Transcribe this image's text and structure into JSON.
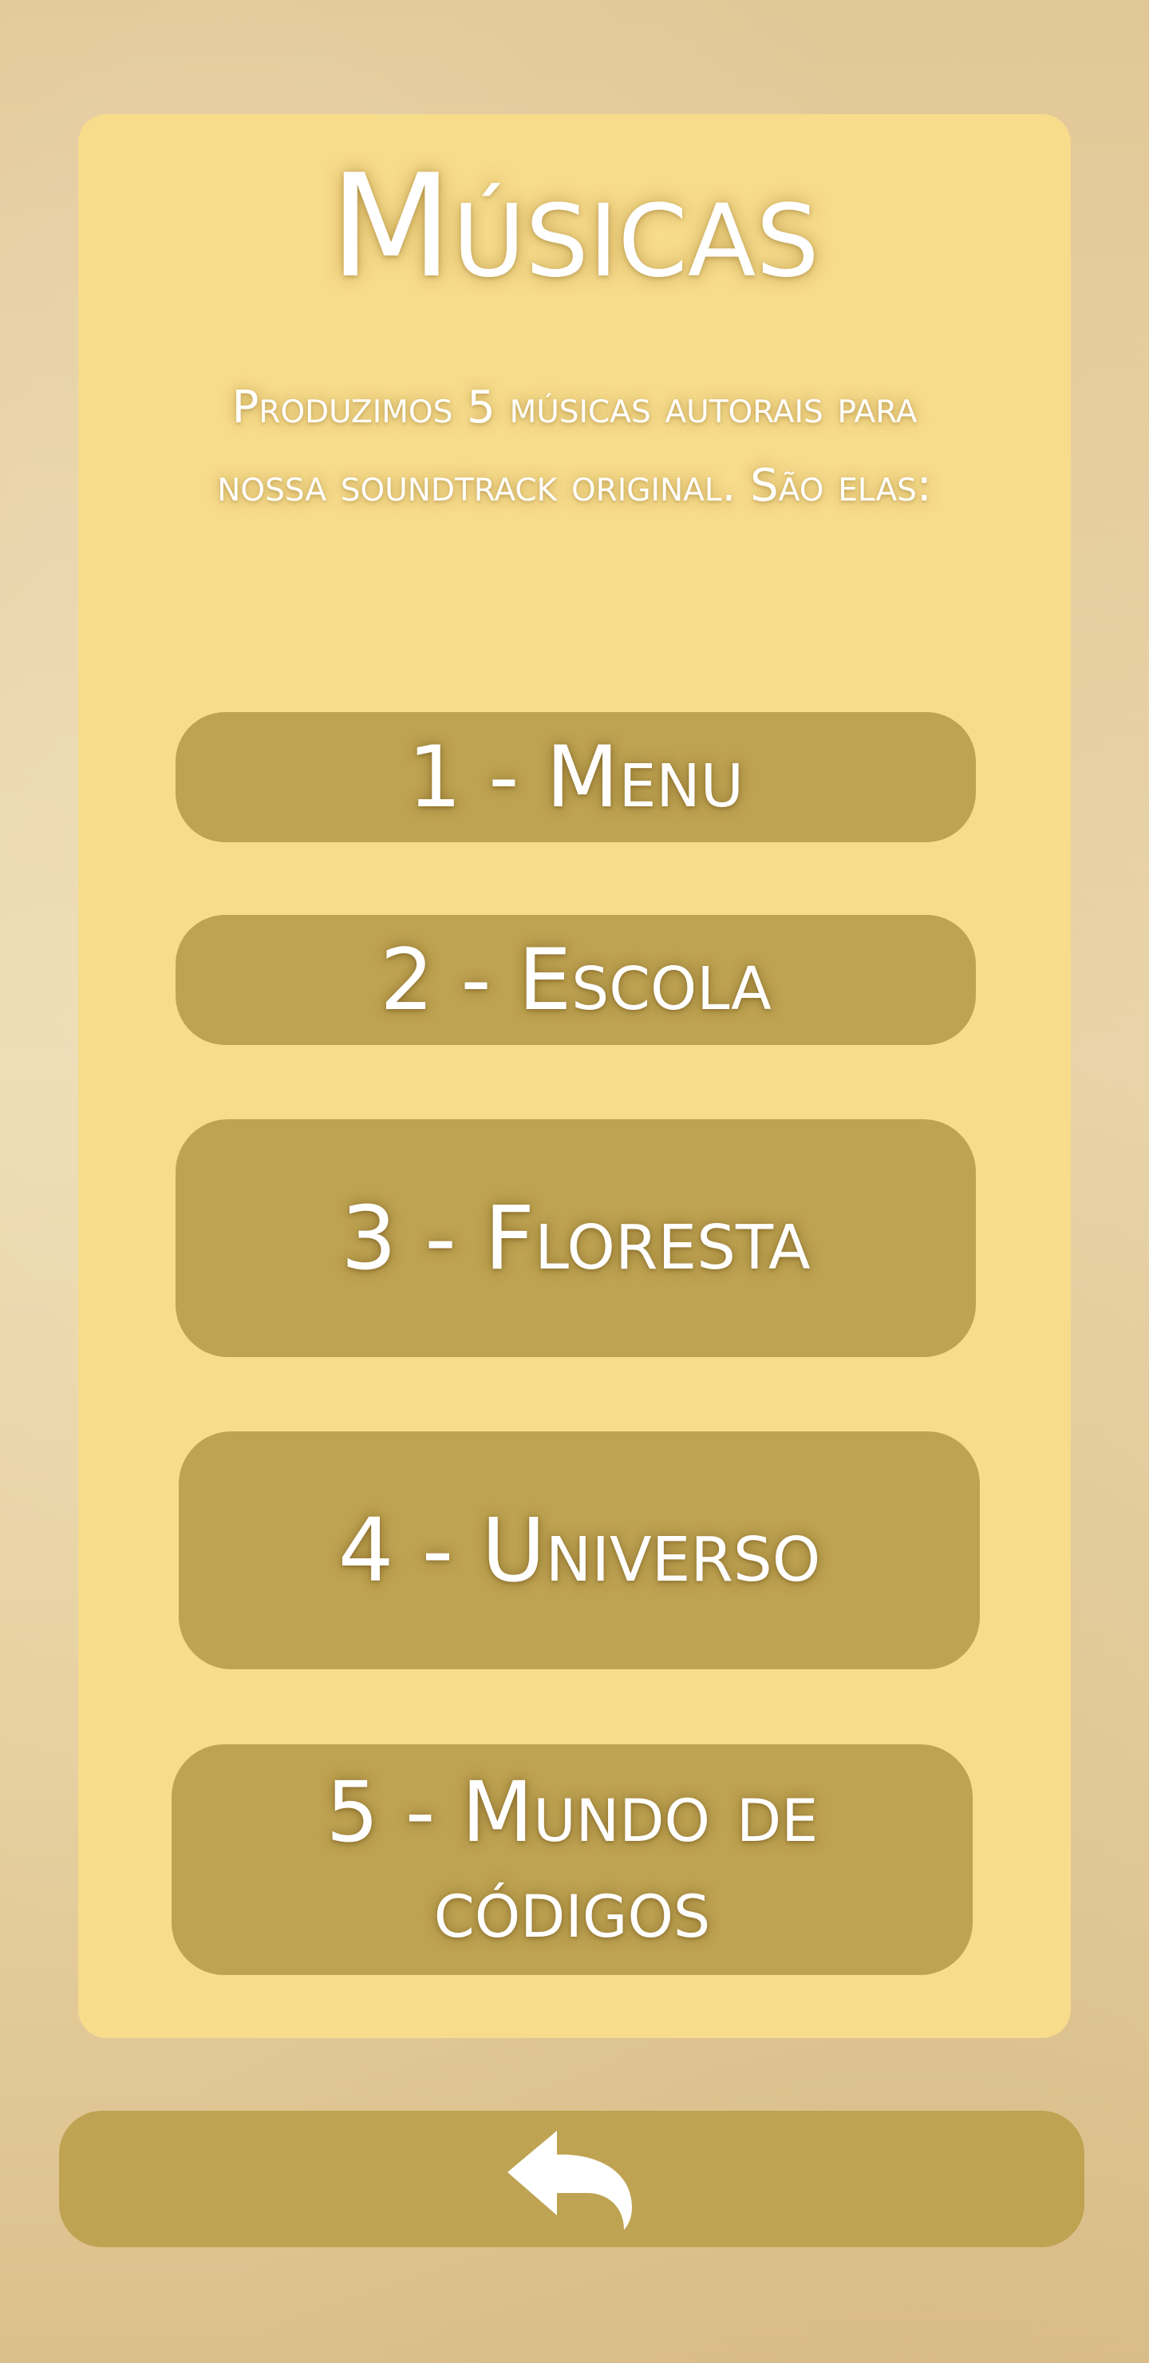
{
  "page": {
    "title": "Músicas",
    "subtitle": "Produzimos 5 músicas autorais para nossa soundtrack original. São elas:"
  },
  "tracks": [
    {
      "label": "1 - Menu"
    },
    {
      "label": "2 - Escola"
    },
    {
      "label": "3 - Floresta"
    },
    {
      "label": "4 - Universo"
    },
    {
      "label": "5 - Mundo de códigos"
    }
  ],
  "navigation": {
    "back_icon": "back-arrow-icon"
  },
  "colors": {
    "background": "#e6cf9e",
    "card": "#f7dc8c",
    "button": "#bea352",
    "text": "#ffffff"
  }
}
